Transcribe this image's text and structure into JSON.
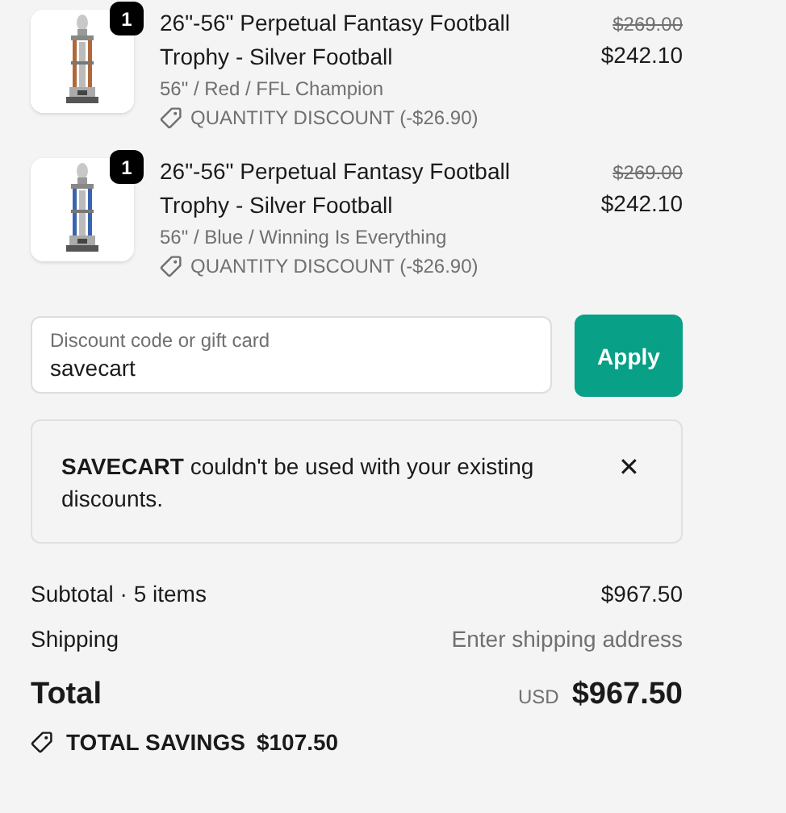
{
  "line_items": [
    {
      "quantity": "1",
      "title": "26\"-56\" Perpetual Fantasy Football Trophy - Silver Football",
      "variant": "56\" / Red / FFL Champion",
      "discount": "QUANTITY DISCOUNT (-$26.90)",
      "original_price": "$269.00",
      "price": "$242.10"
    },
    {
      "quantity": "1",
      "title": "26\"-56\" Perpetual Fantasy Football Trophy - Silver Football",
      "variant": "56\" / Blue / Winning Is Everything",
      "discount": "QUANTITY DISCOUNT (-$26.90)",
      "original_price": "$269.00",
      "price": "$242.10"
    }
  ],
  "discount_field": {
    "placeholder": "Discount code or gift card",
    "value": "savecart"
  },
  "apply_button": "Apply",
  "error_notice": {
    "message": "**SAVECART** couldn't be used with your existing discounts.",
    "close": "✕"
  },
  "summary": [
    {
      "label": "Subtotal · 5 items",
      "value": "$967.50",
      "muted": false
    },
    {
      "label": "Shipping",
      "value": "Enter shipping address",
      "muted": true
    }
  ],
  "total": {
    "label": "Total",
    "currency": "USD",
    "amount": "$967.50"
  },
  "savings": {
    "label": "TOTAL SAVINGS",
    "amount": "$107.50"
  }
}
